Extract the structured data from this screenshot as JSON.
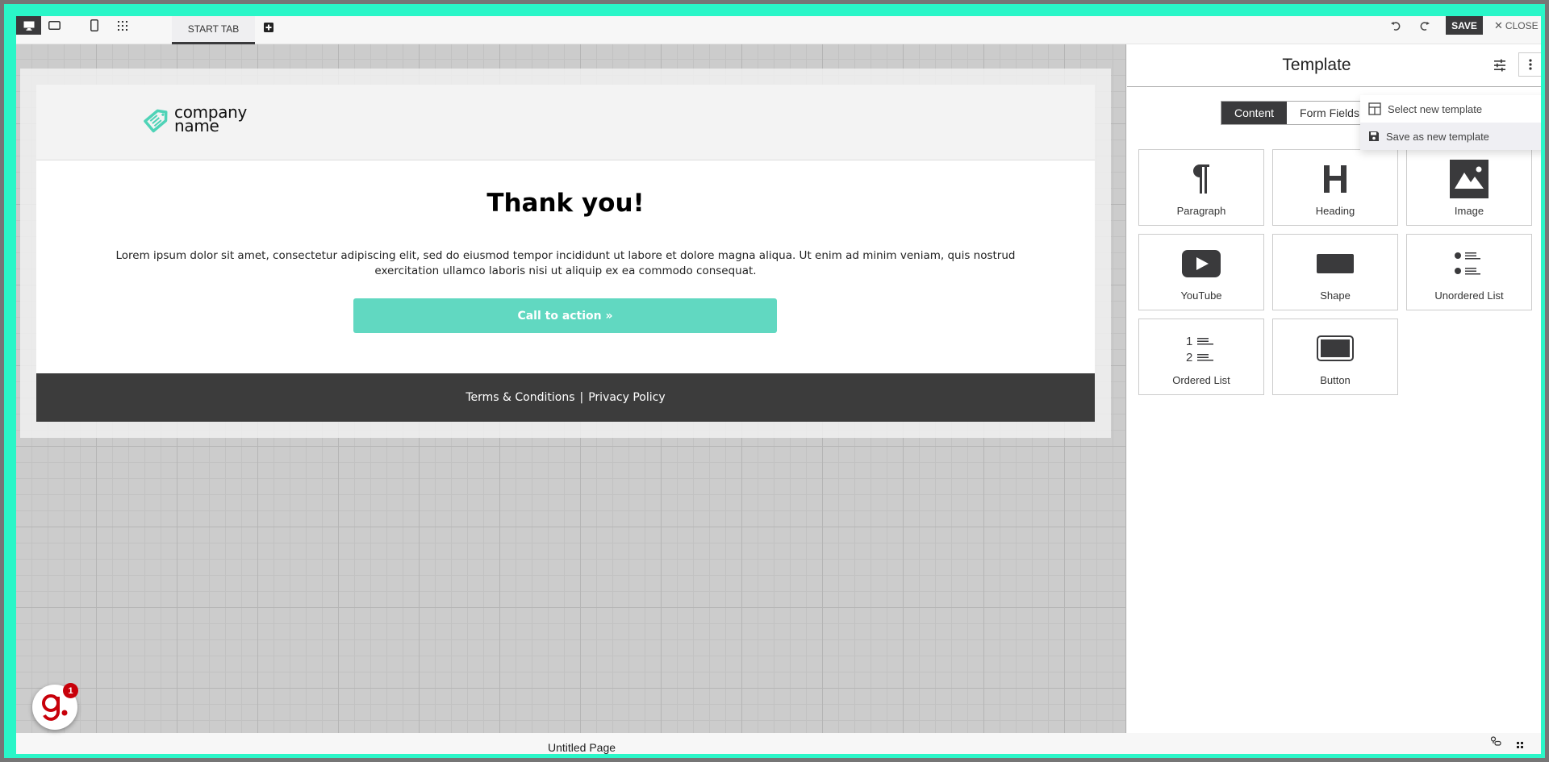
{
  "toolbar": {
    "devices": [
      {
        "name": "desktop",
        "active": true
      },
      {
        "name": "tablet",
        "active": false
      },
      {
        "name": "mobile",
        "active": false
      }
    ],
    "tab_label": "START TAB",
    "save_label": "SAVE",
    "close_label": "CLOSE"
  },
  "page": {
    "logo_line1": "company",
    "logo_line2": "name",
    "title": "Thank you!",
    "paragraph": "Lorem ipsum dolor sit amet, consectetur adipiscing elit, sed do eiusmod tempor incididunt ut labore et dolore magna aliqua. Ut enim ad minim veniam, quis nostrud exercitation ullamco laboris nisi ut aliquip ex ea commodo consequat.",
    "cta_label": "Call to action »",
    "footer_terms": "Terms & Conditions",
    "footer_sep": "|",
    "footer_privacy": "Privacy Policy",
    "accent_color": "#61d8c1"
  },
  "panel": {
    "title": "Template",
    "tabs": [
      {
        "label": "Content",
        "active": true
      },
      {
        "label": "Form Fields",
        "active": false
      }
    ],
    "elements": [
      {
        "label": "Paragraph",
        "icon": "paragraph-icon"
      },
      {
        "label": "Heading",
        "icon": "heading-icon"
      },
      {
        "label": "Image",
        "icon": "image-icon"
      },
      {
        "label": "YouTube",
        "icon": "youtube-icon"
      },
      {
        "label": "Shape",
        "icon": "shape-icon"
      },
      {
        "label": "Unordered List",
        "icon": "unordered-list-icon"
      },
      {
        "label": "Ordered List",
        "icon": "ordered-list-icon"
      },
      {
        "label": "Button",
        "icon": "button-icon"
      }
    ],
    "menu": [
      {
        "label": "Select new template",
        "icon": "table-icon"
      },
      {
        "label": "Save as new template",
        "icon": "floppy-icon"
      }
    ]
  },
  "footer": {
    "page_name": "Untitled Page"
  },
  "chat": {
    "badge_count": "1"
  }
}
